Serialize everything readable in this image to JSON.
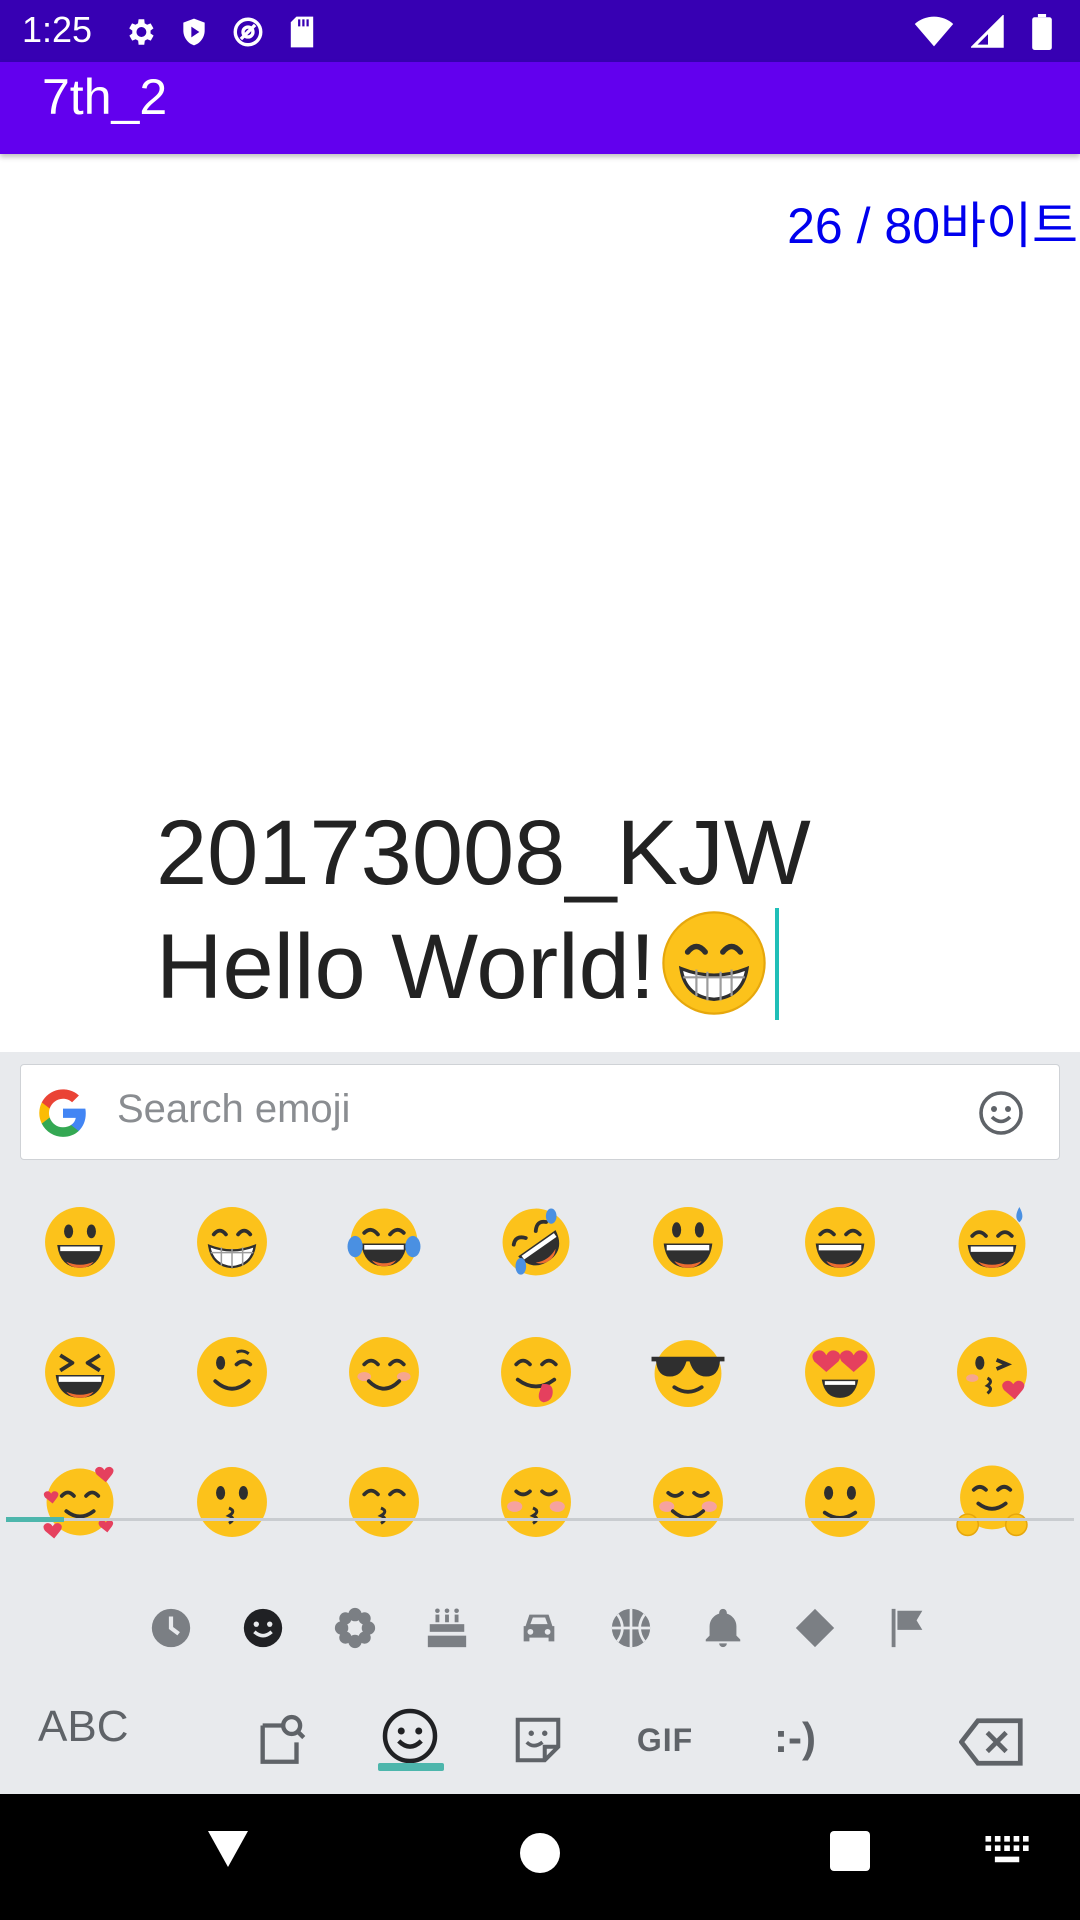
{
  "status_bar": {
    "time": "1:25",
    "bg_color": "#3700b3",
    "left_icons": [
      "gear-icon",
      "shield-play-icon",
      "at-sync-icon",
      "sd-card-icon"
    ],
    "right_icons": [
      "wifi-icon",
      "cell-signal-icon",
      "battery-icon"
    ]
  },
  "app_bar": {
    "title": "7th_2",
    "bg_color": "#6200ee"
  },
  "content": {
    "byte_counter": "26 / 80바이트",
    "byte_counter_color": "#0000ee",
    "edit_text": {
      "line1": "20173008_KJW",
      "line2": "Hello World!",
      "trailing_emoji": "grinning-face-smiling-eyes-emoji",
      "cursor_color": "#1fbfb8"
    }
  },
  "keyboard": {
    "search": {
      "placeholder": "Search emoji",
      "leading_icon": "google-g-icon",
      "trailing_icon": "smiley-outline-icon"
    },
    "emoji_rows": [
      [
        "grinning-face",
        "beaming-face",
        "tears-of-joy",
        "rolling-on-floor-laughing",
        "grinning-big-eyes",
        "grinning-smiling-eyes",
        "grinning-sweat"
      ],
      [
        "squinting-laughing",
        "winking-face",
        "smiling-blush",
        "savoring-food",
        "sunglasses-face",
        "heart-eyes",
        "kissing-heart"
      ],
      [
        "smiling-hearts",
        "kissing-face",
        "kissing-smiling-eyes",
        "kissing-closed-eyes",
        "smiling-face",
        "slightly-smiling",
        "hugging-face"
      ]
    ],
    "categories": [
      "recent-clock-icon",
      "smileys-icon",
      "nature-flower-icon",
      "food-cake-icon",
      "travel-car-icon",
      "activity-ball-icon",
      "objects-bell-icon",
      "symbols-diamond-icon",
      "flags-flag-icon"
    ],
    "active_category": "smileys-icon",
    "bottom_row": {
      "abc_label": "ABC",
      "gif_label": "GIF",
      "emoticon_label": ":-)",
      "icons": [
        "emoji-search-icon",
        "emoji-tab-icon",
        "sticker-icon",
        "backspace-icon"
      ]
    },
    "accent_color": "#4db6ac"
  },
  "nav_bar": {
    "buttons": [
      "back-triangle-icon",
      "home-circle-icon",
      "recents-square-icon",
      "keyboard-switch-icon"
    ]
  }
}
